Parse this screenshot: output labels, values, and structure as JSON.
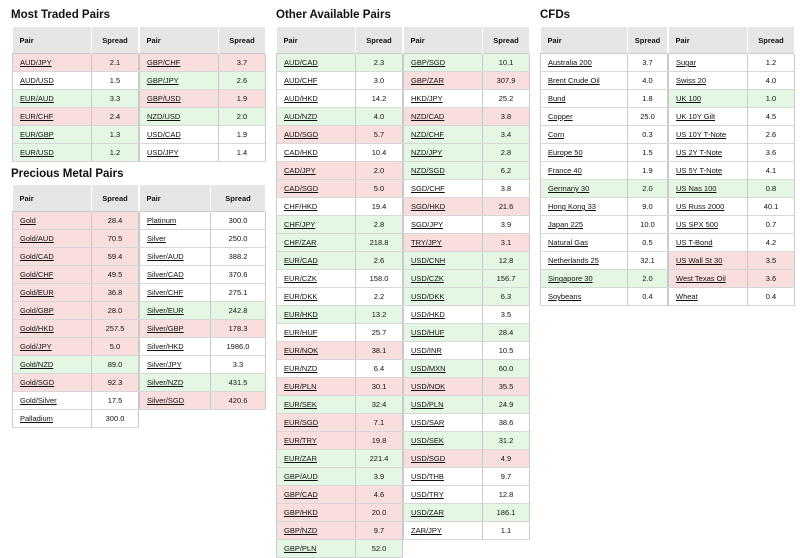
{
  "headers": {
    "pair": "Pair",
    "spread": "Spread"
  },
  "sections": {
    "most_traded": {
      "title": "Most Traded Pairs",
      "left": [
        {
          "pair": "AUD/JPY",
          "spread": "2.1",
          "hl": "r"
        },
        {
          "pair": "AUD/USD",
          "spread": "1.5",
          "hl": "w"
        },
        {
          "pair": "EUR/AUD",
          "spread": "3.3",
          "hl": "g"
        },
        {
          "pair": "EUR/CHF",
          "spread": "2.4",
          "hl": "r"
        },
        {
          "pair": "EUR/GBP",
          "spread": "1.3",
          "hl": "g"
        },
        {
          "pair": "EUR/USD",
          "spread": "1.2",
          "hl": "g"
        }
      ],
      "right": [
        {
          "pair": "GBP/CHF",
          "spread": "3.7",
          "hl": "r"
        },
        {
          "pair": "GBP/JPY",
          "spread": "2.6",
          "hl": "g"
        },
        {
          "pair": "GBP/USD",
          "spread": "1.9",
          "hl": "r"
        },
        {
          "pair": "NZD/USD",
          "spread": "2.0",
          "hl": "g"
        },
        {
          "pair": "USD/CAD",
          "spread": "1.9",
          "hl": "w"
        },
        {
          "pair": "USD/JPY",
          "spread": "1.4",
          "hl": "w"
        }
      ]
    },
    "precious_metals": {
      "title": "Precious Metal Pairs",
      "left": [
        {
          "pair": "Gold",
          "spread": "28.4",
          "hl": "r"
        },
        {
          "pair": "Gold/AUD",
          "spread": "70.5",
          "hl": "r"
        },
        {
          "pair": "Gold/CAD",
          "spread": "59.4",
          "hl": "r"
        },
        {
          "pair": "Gold/CHF",
          "spread": "49.5",
          "hl": "r"
        },
        {
          "pair": "Gold/EUR",
          "spread": "36.8",
          "hl": "r"
        },
        {
          "pair": "Gold/GBP",
          "spread": "28.0",
          "hl": "r"
        },
        {
          "pair": "Gold/HKD",
          "spread": "257.5",
          "hl": "r"
        },
        {
          "pair": "Gold/JPY",
          "spread": "5.0",
          "hl": "r"
        },
        {
          "pair": "Gold/NZD",
          "spread": "89.0",
          "hl": "g"
        },
        {
          "pair": "Gold/SGD",
          "spread": "92.3",
          "hl": "r"
        },
        {
          "pair": "Gold/Silver",
          "spread": "17.5",
          "hl": "w"
        },
        {
          "pair": "Palladium",
          "spread": "300.0",
          "hl": "w"
        }
      ],
      "right": [
        {
          "pair": "Platinum",
          "spread": "300.0",
          "hl": "w"
        },
        {
          "pair": "Silver",
          "spread": "250.0",
          "hl": "w"
        },
        {
          "pair": "Silver/AUD",
          "spread": "388.2",
          "hl": "w"
        },
        {
          "pair": "Silver/CAD",
          "spread": "370.6",
          "hl": "w"
        },
        {
          "pair": "Silver/CHF",
          "spread": "275.1",
          "hl": "w"
        },
        {
          "pair": "Silver/EUR",
          "spread": "242.8",
          "hl": "g"
        },
        {
          "pair": "Silver/GBP",
          "spread": "178.3",
          "hl": "r"
        },
        {
          "pair": "Silver/HKD",
          "spread": "1986.0",
          "hl": "w"
        },
        {
          "pair": "Silver/JPY",
          "spread": "3.3",
          "hl": "w"
        },
        {
          "pair": "Silver/NZD",
          "spread": "431.5",
          "hl": "g"
        },
        {
          "pair": "Silver/SGD",
          "spread": "420.6",
          "hl": "r"
        }
      ]
    },
    "other_pairs": {
      "title": "Other Available Pairs",
      "left": [
        {
          "pair": "AUD/CAD",
          "spread": "2.3",
          "hl": "g"
        },
        {
          "pair": "AUD/CHF",
          "spread": "3.0",
          "hl": "w"
        },
        {
          "pair": "AUD/HKD",
          "spread": "14.2",
          "hl": "w"
        },
        {
          "pair": "AUD/NZD",
          "spread": "4.0",
          "hl": "g"
        },
        {
          "pair": "AUD/SGD",
          "spread": "5.7",
          "hl": "r"
        },
        {
          "pair": "CAD/HKD",
          "spread": "10.4",
          "hl": "w"
        },
        {
          "pair": "CAD/JPY",
          "spread": "2.0",
          "hl": "r"
        },
        {
          "pair": "CAD/SGD",
          "spread": "5.0",
          "hl": "r"
        },
        {
          "pair": "CHF/HKD",
          "spread": "19.4",
          "hl": "w"
        },
        {
          "pair": "CHF/JPY",
          "spread": "2.8",
          "hl": "g"
        },
        {
          "pair": "CHF/ZAR",
          "spread": "218.8",
          "hl": "g"
        },
        {
          "pair": "EUR/CAD",
          "spread": "2.6",
          "hl": "g"
        },
        {
          "pair": "EUR/CZK",
          "spread": "158.0",
          "hl": "w"
        },
        {
          "pair": "EUR/DKK",
          "spread": "2.2",
          "hl": "w"
        },
        {
          "pair": "EUR/HKD",
          "spread": "13.2",
          "hl": "g"
        },
        {
          "pair": "EUR/HUF",
          "spread": "25.7",
          "hl": "w"
        },
        {
          "pair": "EUR/NOK",
          "spread": "38.1",
          "hl": "r"
        },
        {
          "pair": "EUR/NZD",
          "spread": "6.4",
          "hl": "w"
        },
        {
          "pair": "EUR/PLN",
          "spread": "30.1",
          "hl": "r"
        },
        {
          "pair": "EUR/SEK",
          "spread": "32.4",
          "hl": "g"
        },
        {
          "pair": "EUR/SGD",
          "spread": "7.1",
          "hl": "r"
        },
        {
          "pair": "EUR/TRY",
          "spread": "19.8",
          "hl": "r"
        },
        {
          "pair": "EUR/ZAR",
          "spread": "221.4",
          "hl": "g"
        },
        {
          "pair": "GBP/AUD",
          "spread": "3.9",
          "hl": "g"
        },
        {
          "pair": "GBP/CAD",
          "spread": "4.6",
          "hl": "r"
        },
        {
          "pair": "GBP/HKD",
          "spread": "20.0",
          "hl": "r"
        },
        {
          "pair": "GBP/NZD",
          "spread": "9.7",
          "hl": "r"
        },
        {
          "pair": "GBP/PLN",
          "spread": "52.0",
          "hl": "g"
        }
      ],
      "right": [
        {
          "pair": "GBP/SGD",
          "spread": "10.1",
          "hl": "g"
        },
        {
          "pair": "GBP/ZAR",
          "spread": "307.9",
          "hl": "r"
        },
        {
          "pair": "HKD/JPY",
          "spread": "25.2",
          "hl": "w"
        },
        {
          "pair": "NZD/CAD",
          "spread": "3.8",
          "hl": "r"
        },
        {
          "pair": "NZD/CHF",
          "spread": "3.4",
          "hl": "g"
        },
        {
          "pair": "NZD/JPY",
          "spread": "2.8",
          "hl": "g"
        },
        {
          "pair": "NZD/SGD",
          "spread": "6.2",
          "hl": "g"
        },
        {
          "pair": "SGD/CHF",
          "spread": "3.8",
          "hl": "w"
        },
        {
          "pair": "SGD/HKD",
          "spread": "21.6",
          "hl": "r"
        },
        {
          "pair": "SGD/JPY",
          "spread": "3.9",
          "hl": "w"
        },
        {
          "pair": "TRY/JPY",
          "spread": "3.1",
          "hl": "r"
        },
        {
          "pair": "USD/CNH",
          "spread": "12.8",
          "hl": "g"
        },
        {
          "pair": "USD/CZK",
          "spread": "156.7",
          "hl": "g"
        },
        {
          "pair": "USD/DKK",
          "spread": "6.3",
          "hl": "g"
        },
        {
          "pair": "USD/HKD",
          "spread": "3.5",
          "hl": "w"
        },
        {
          "pair": "USD/HUF",
          "spread": "28.4",
          "hl": "g"
        },
        {
          "pair": "USD/INR",
          "spread": "10.5",
          "hl": "w"
        },
        {
          "pair": "USD/MXN",
          "spread": "60.0",
          "hl": "g"
        },
        {
          "pair": "USD/NOK",
          "spread": "35.5",
          "hl": "r"
        },
        {
          "pair": "USD/PLN",
          "spread": "24.9",
          "hl": "g"
        },
        {
          "pair": "USD/SAR",
          "spread": "38.6",
          "hl": "w"
        },
        {
          "pair": "USD/SEK",
          "spread": "31.2",
          "hl": "g"
        },
        {
          "pair": "USD/SGD",
          "spread": "4.9",
          "hl": "r"
        },
        {
          "pair": "USD/THB",
          "spread": "9.7",
          "hl": "w"
        },
        {
          "pair": "USD/TRY",
          "spread": "12.8",
          "hl": "w"
        },
        {
          "pair": "USD/ZAR",
          "spread": "186.1",
          "hl": "g"
        },
        {
          "pair": "ZAR/JPY",
          "spread": "1.1",
          "hl": "w"
        }
      ]
    },
    "cfds": {
      "title": "CFDs",
      "left": [
        {
          "pair": "Australia 200",
          "spread": "3.7",
          "hl": "w"
        },
        {
          "pair": "Brent Crude Oil",
          "spread": "4.0",
          "hl": "w"
        },
        {
          "pair": "Bund",
          "spread": "1.8",
          "hl": "w"
        },
        {
          "pair": "Copper",
          "spread": "25.0",
          "hl": "w"
        },
        {
          "pair": "Corn",
          "spread": "0.3",
          "hl": "w"
        },
        {
          "pair": "Europe 50",
          "spread": "1.5",
          "hl": "w"
        },
        {
          "pair": "France 40",
          "spread": "1.9",
          "hl": "w"
        },
        {
          "pair": "Germany 30",
          "spread": "2.0",
          "hl": "g"
        },
        {
          "pair": "Hong Kong 33",
          "spread": "9.0",
          "hl": "w"
        },
        {
          "pair": "Japan 225",
          "spread": "10.0",
          "hl": "w"
        },
        {
          "pair": "Natural Gas",
          "spread": "0.5",
          "hl": "w"
        },
        {
          "pair": "Netherlands 25",
          "spread": "32.1",
          "hl": "w"
        },
        {
          "pair": "Singapore 30",
          "spread": "2.0",
          "hl": "g"
        },
        {
          "pair": "Soybeans",
          "spread": "0.4",
          "hl": "w"
        }
      ],
      "right": [
        {
          "pair": "Sugar",
          "spread": "1.2",
          "hl": "w"
        },
        {
          "pair": "Swiss 20",
          "spread": "4.0",
          "hl": "w"
        },
        {
          "pair": "UK 100",
          "spread": "1.0",
          "hl": "g"
        },
        {
          "pair": "UK 10Y Gilt",
          "spread": "4.5",
          "hl": "w"
        },
        {
          "pair": "US 10Y T-Note",
          "spread": "2.6",
          "hl": "w"
        },
        {
          "pair": "US 2Y T-Note",
          "spread": "3.6",
          "hl": "w"
        },
        {
          "pair": "US 5Y T-Note",
          "spread": "4.1",
          "hl": "w"
        },
        {
          "pair": "US Nas 100",
          "spread": "0.8",
          "hl": "g"
        },
        {
          "pair": "US Russ 2000",
          "spread": "40.1",
          "hl": "w"
        },
        {
          "pair": "US SPX 500",
          "spread": "0.7",
          "hl": "w"
        },
        {
          "pair": "US T-Bond",
          "spread": "4.2",
          "hl": "w"
        },
        {
          "pair": "US Wall St 30",
          "spread": "3.5",
          "hl": "r"
        },
        {
          "pair": "West Texas Oil",
          "spread": "3.6",
          "hl": "r"
        },
        {
          "pair": "Wheat",
          "spread": "0.4",
          "hl": "w"
        }
      ]
    }
  }
}
